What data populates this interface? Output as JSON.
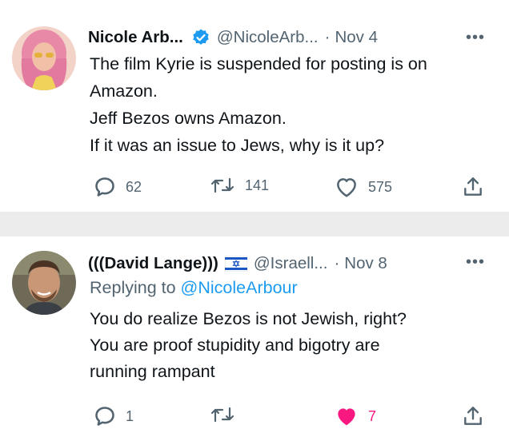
{
  "tweets": [
    {
      "name": "Nicole Arb...",
      "handle": "@NicoleArb...",
      "dot": "·",
      "date": "Nov 4",
      "more": "•••",
      "verified": true,
      "lines": [
        "The film Kyrie is suspended for posting is on",
        "Amazon.",
        "Jeff Bezos owns Amazon.",
        "If it was an issue to Jews, why is it up?"
      ],
      "replies": "62",
      "retweets": "141",
      "likes": "575"
    },
    {
      "name": "(((David Lange)))",
      "handle": "@Israell...",
      "dot": "·",
      "date": "Nov 8",
      "more": "•••",
      "flag": "israel-flag",
      "replying_prefix": "Replying to ",
      "replying_to": "@NicoleArbour",
      "lines": [
        "You do realize Bezos is not Jewish, right?",
        "You are proof stupidity and bigotry are",
        "running rampant"
      ],
      "replies": "1",
      "retweets": "",
      "likes": "7",
      "liked": true
    }
  ],
  "colors": {
    "accent": "#1d9bf0",
    "like": "#f91880",
    "muted": "#536471",
    "text": "#0f1419",
    "background": "#ececec"
  }
}
